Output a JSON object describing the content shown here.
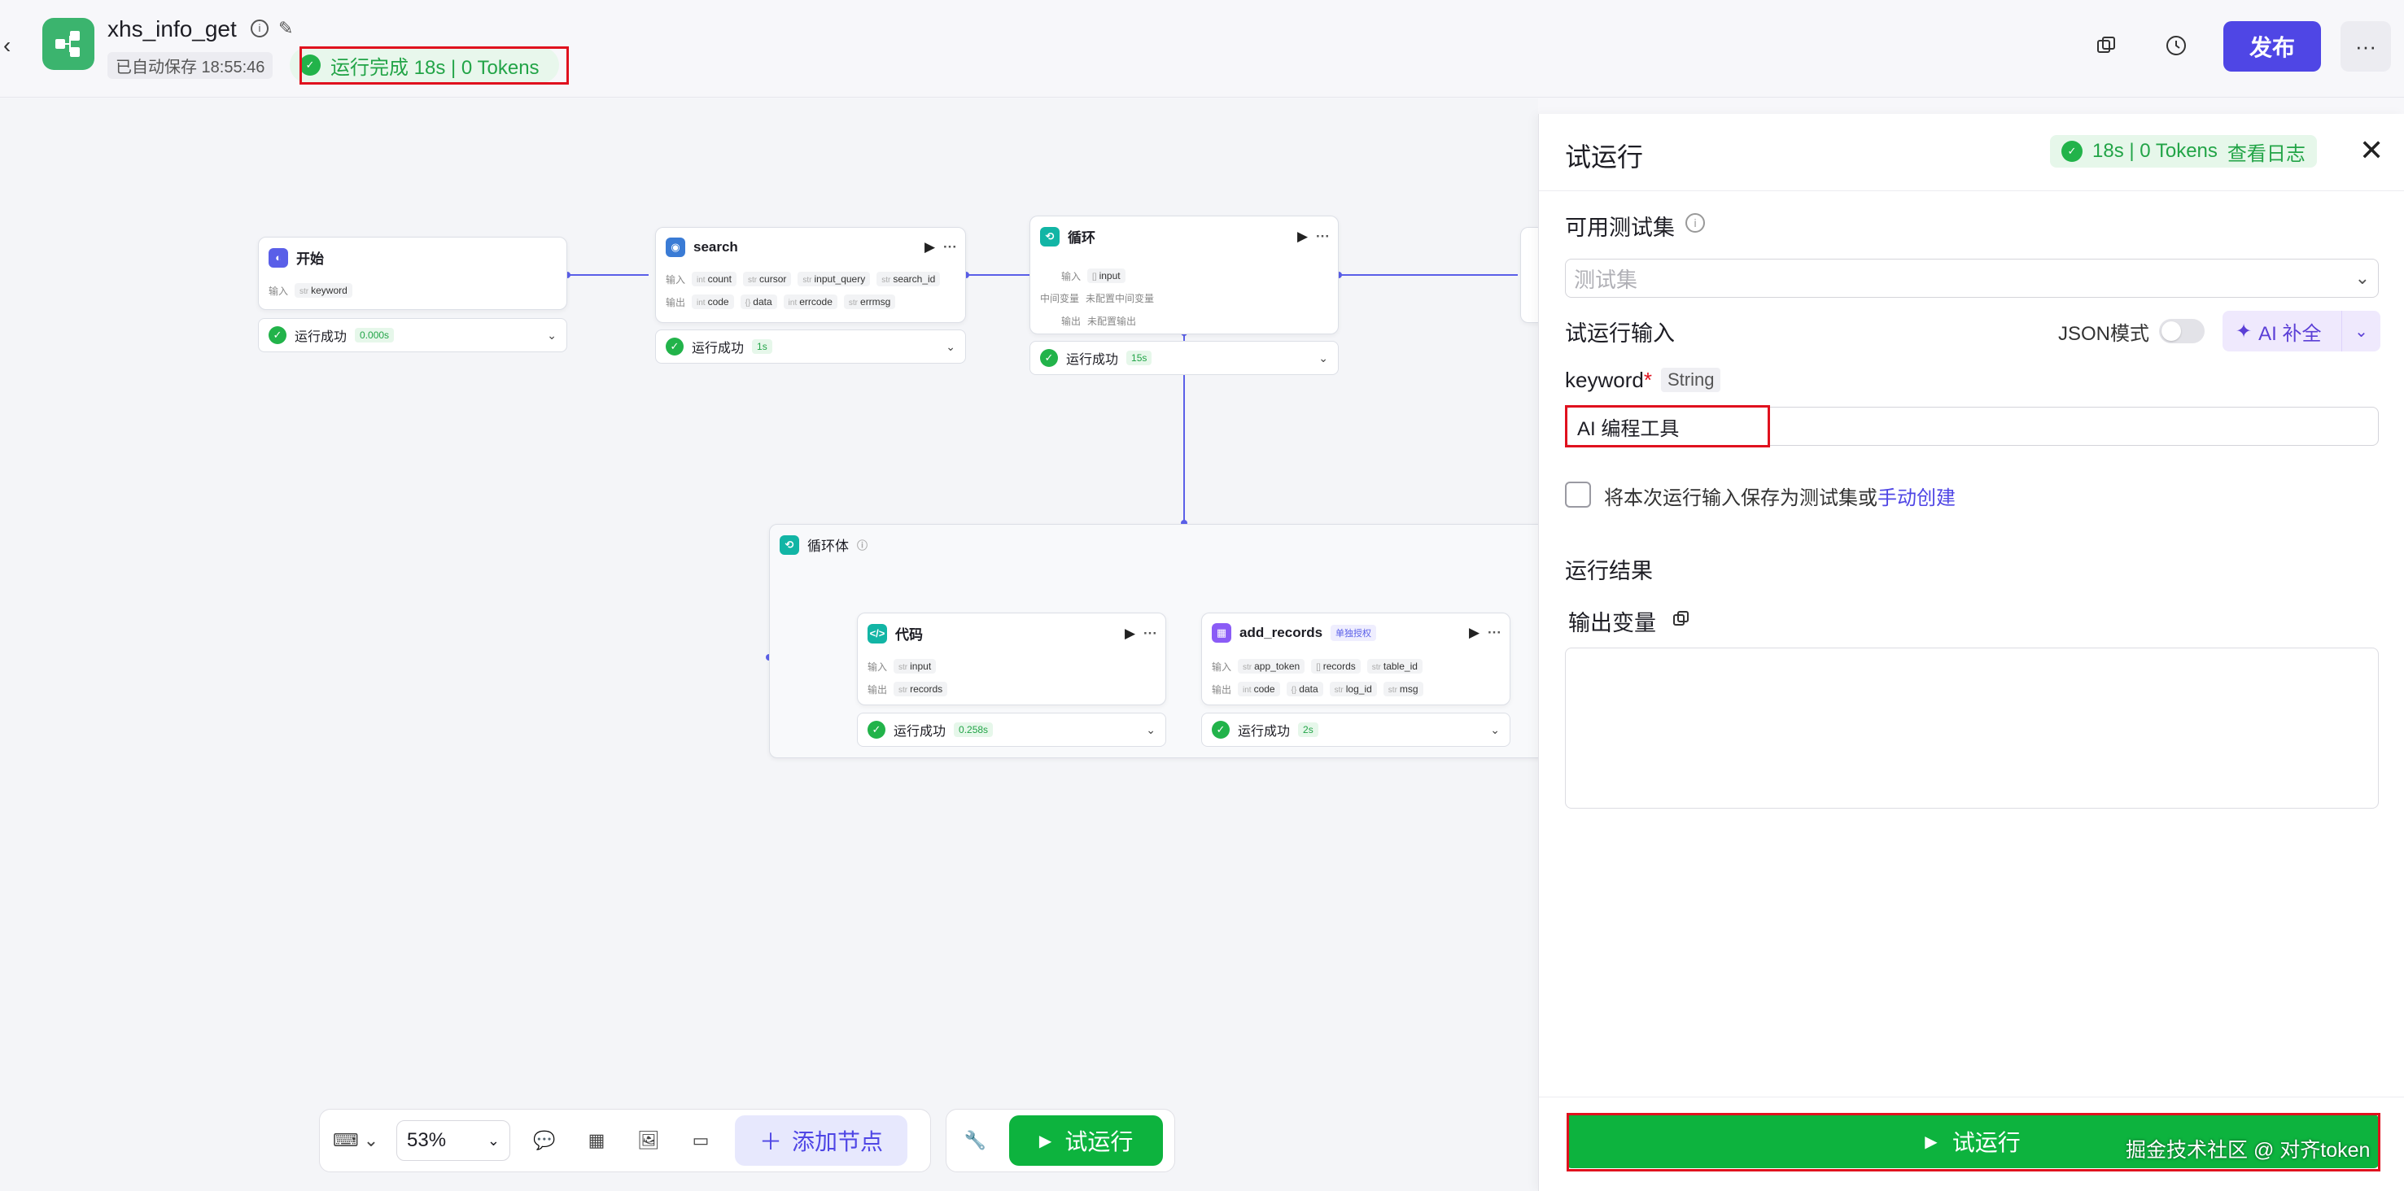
{
  "header": {
    "back_icon": "chevron-left-icon",
    "app_name": "xhs_info_get",
    "autosave": "已自动保存 18:55:46",
    "run_status": "运行完成 18s | 0 Tokens",
    "publish_label": "发布",
    "more_label": "···"
  },
  "nodes": {
    "start": {
      "title": "开始",
      "in_label": "输入",
      "in_vars": [
        "keyword"
      ],
      "status": "运行成功",
      "time": "0.000s"
    },
    "search": {
      "title": "search",
      "in_label": "输入",
      "out_label": "输出",
      "in_vars": [
        "count",
        "cursor",
        "input_query",
        "search_id"
      ],
      "out_vars": [
        "code",
        "data",
        "errcode",
        "errmsg"
      ],
      "status": "运行成功",
      "time": "1s"
    },
    "loop": {
      "title": "循环",
      "in_label": "输入",
      "mid_label": "中间变量",
      "mid_value": "未配置中间变量",
      "out_label": "输出",
      "out_value": "未配置输出",
      "in_vars": [
        "input"
      ],
      "status": "运行成功",
      "time": "15s"
    },
    "loop_body": {
      "title": "循环体"
    },
    "code": {
      "title": "代码",
      "in_label": "输入",
      "out_label": "输出",
      "in_vars": [
        "input"
      ],
      "out_vars": [
        "records"
      ],
      "status": "运行成功",
      "time": "0.258s"
    },
    "add_records": {
      "title": "add_records",
      "badge": "单独授权",
      "in_label": "输入",
      "out_label": "输出",
      "in_vars": [
        "app_token",
        "records",
        "table_id"
      ],
      "out_vars": [
        "code",
        "data",
        "log_id",
        "msg"
      ],
      "status": "运行成功",
      "time": "2s"
    }
  },
  "toolbar": {
    "zoom": "53%",
    "add_node": "添加节点",
    "test_run": "试运行"
  },
  "panel": {
    "title": "试运行",
    "status": "18s | 0 Tokens",
    "view_log": "查看日志",
    "testset_label": "可用测试集",
    "testset_placeholder": "测试集",
    "input_label": "试运行输入",
    "json_mode": "JSON模式",
    "ai_fill": "AI 补全",
    "field_name": "keyword",
    "field_type": "String",
    "field_value": "AI 编程工具",
    "save_text": "将本次运行输入保存为测试集或",
    "save_link": "手动创建",
    "result_label": "运行结果",
    "output_label": "输出变量",
    "run_button": "试运行"
  },
  "watermark": "掘金技术社区 @ 对齐token",
  "colors": {
    "accent": "#4f46e5",
    "success": "#22b34a",
    "run_button": "#0db33e"
  }
}
